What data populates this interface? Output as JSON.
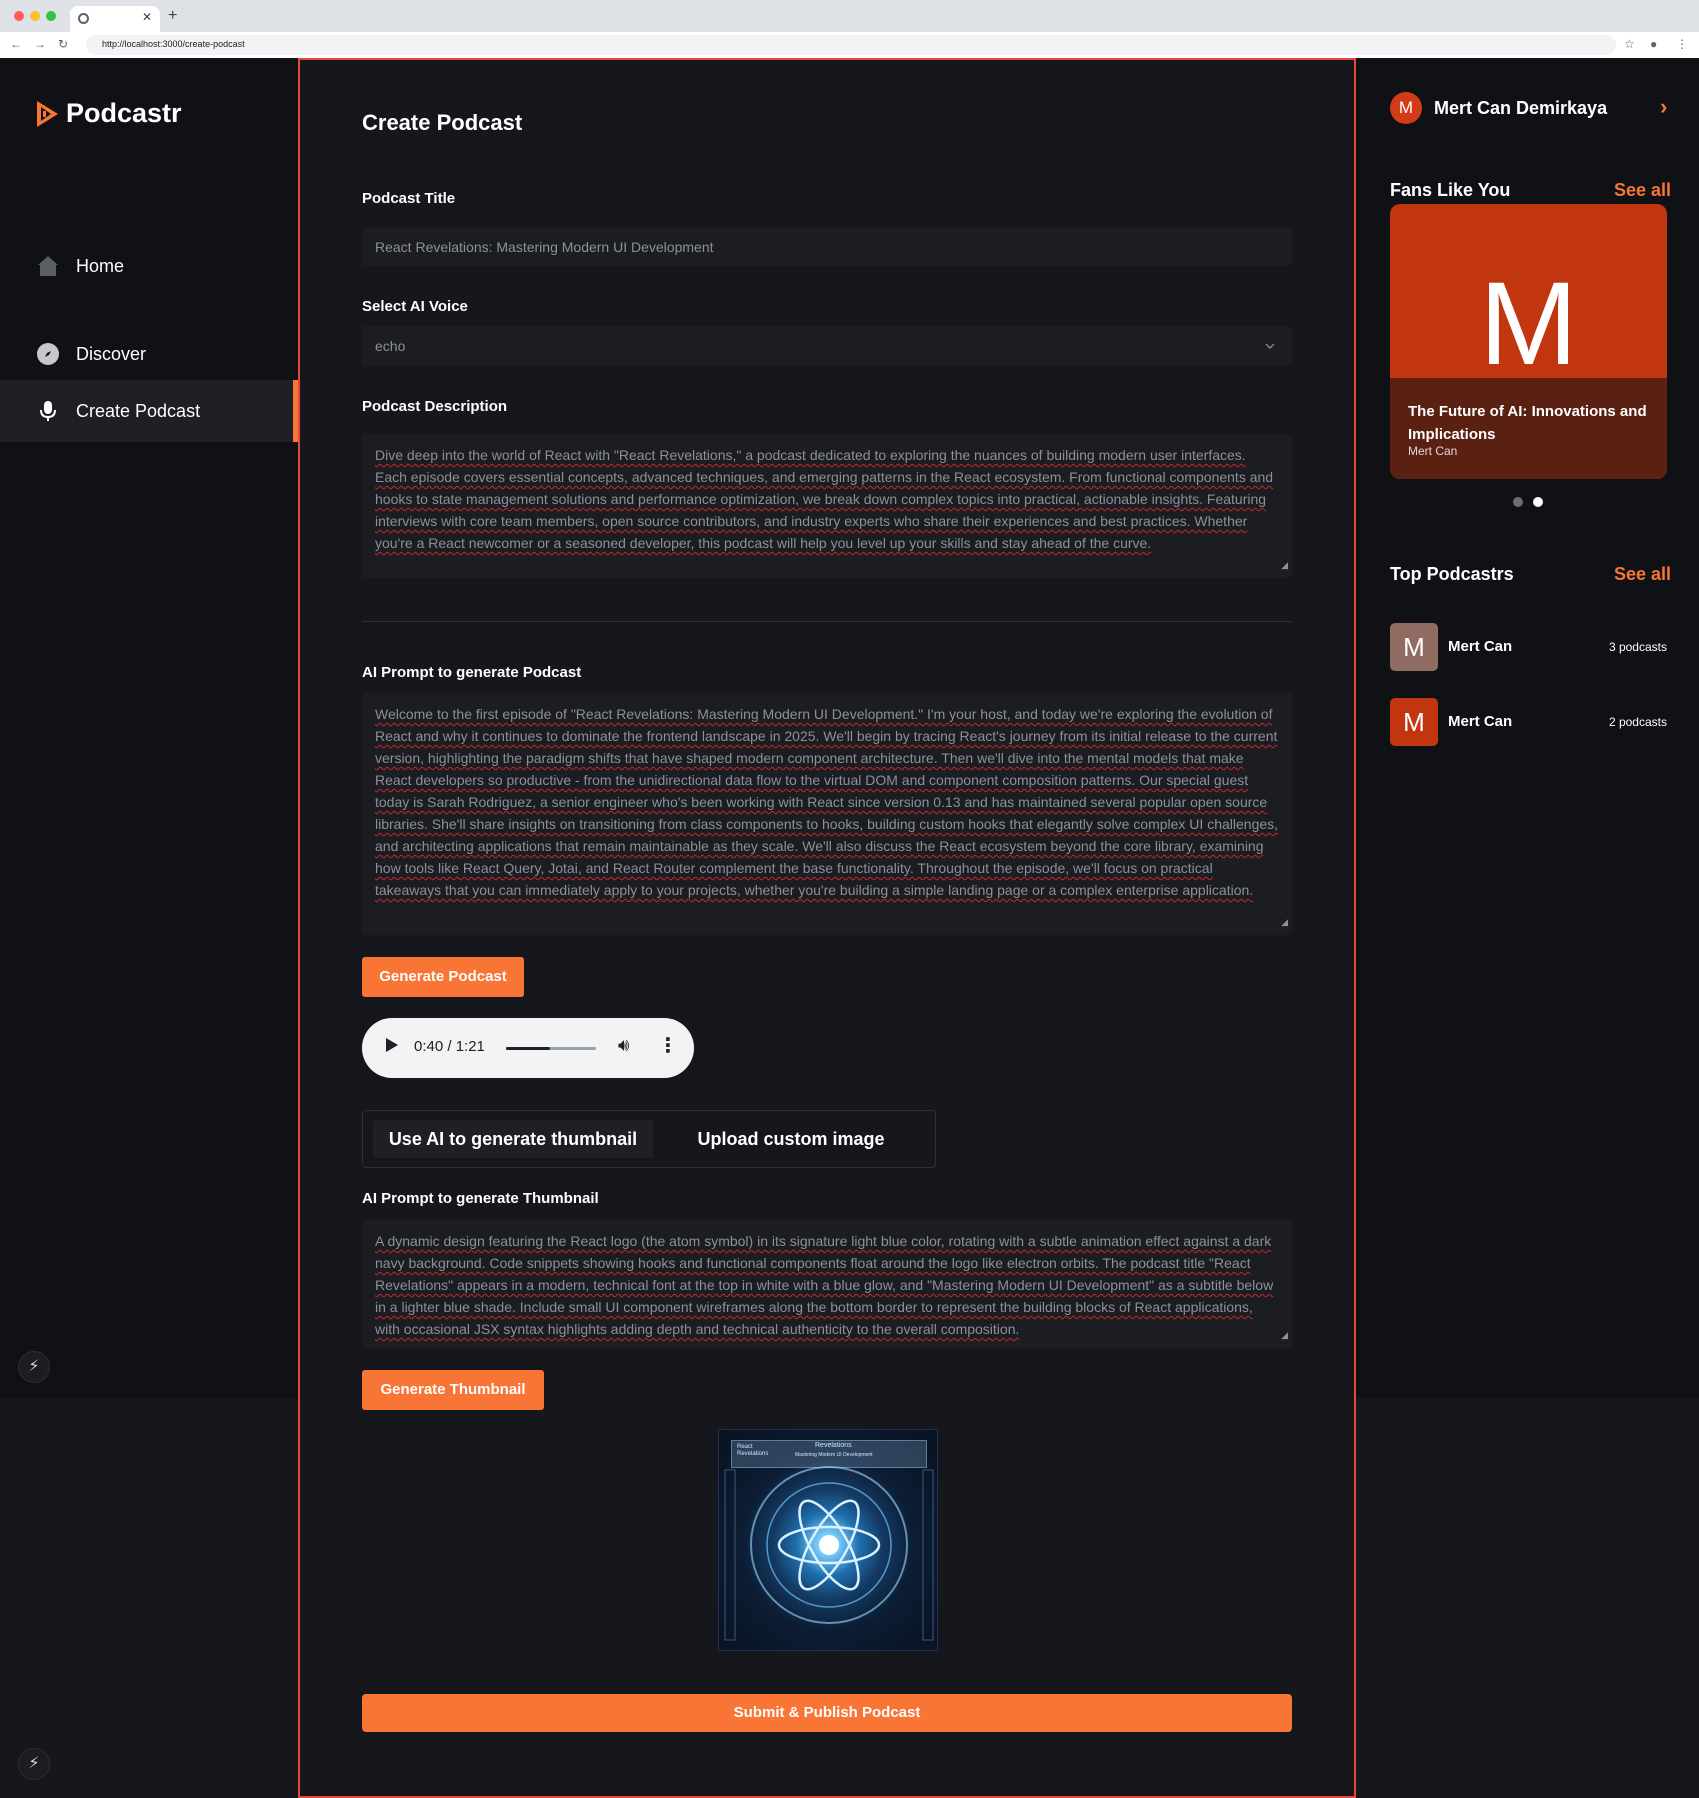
{
  "browser": {
    "url": "http://localhost:3000/create-podcast"
  },
  "sidebar": {
    "logo_text": "Podcastr",
    "items": [
      {
        "label": "Home",
        "icon": "home-icon"
      },
      {
        "label": "Discover",
        "icon": "compass-icon"
      },
      {
        "label": "Create Podcast",
        "icon": "microphone-icon"
      }
    ],
    "active_item": "Create Podcast"
  },
  "main": {
    "page_title": "Create Podcast",
    "podcast_title_label": "Podcast Title",
    "podcast_title_value": "React Revelations: Mastering Modern UI Development",
    "voice_label": "Select AI Voice",
    "voice_value": "echo",
    "description_label": "Podcast Description",
    "description_value": "Dive deep into the world of React with \"React Revelations,\" a podcast dedicated to exploring the nuances of building modern user interfaces. Each episode covers essential concepts, advanced techniques, and emerging patterns in the React ecosystem. From functional components and hooks to state management solutions and performance optimization, we break down complex topics into practical, actionable insights. Featuring interviews with core team members, open source contributors, and industry experts who share their experiences and best practices. Whether you're a React newcomer or a seasoned developer, this podcast will help you level up your skills and stay ahead of the curve.",
    "ai_prompt_label": "AI Prompt to generate Podcast",
    "ai_prompt_value": "Welcome to the first episode of \"React Revelations: Mastering Modern UI Development.\" I'm your host, and today we're exploring the evolution of React and why it continues to dominate the frontend landscape in 2025. We'll begin by tracing React's journey from its initial release to the current version, highlighting the paradigm shifts that have shaped modern component architecture. Then we'll dive into the mental models that make React developers so productive - from the unidirectional data flow to the virtual DOM and component composition patterns. Our special guest today is Sarah Rodriguez, a senior engineer who's been working with React since version 0.13 and has maintained several popular open source libraries. She'll share insights on transitioning from class components to hooks, building custom hooks that elegantly solve complex UI challenges, and architecting applications that remain maintainable as they scale. We'll also discuss the React ecosystem beyond the core library, examining how tools like React Query, Jotai, and React Router complement the base functionality. Throughout the episode, we'll focus on practical takeaways that you can immediately apply to your projects, whether you're building a simple landing page or a complex enterprise application.",
    "generate_podcast_label": "Generate Podcast",
    "audio": {
      "time": "0:40 / 1:21",
      "progress": 0.49
    },
    "thumbnail_tabs": [
      "Use AI to generate thumbnail",
      "Upload custom image"
    ],
    "thumbnail_prompt_label": "AI Prompt to generate Thumbnail",
    "thumbnail_prompt_value": "A dynamic design featuring the React logo (the atom symbol) in its signature light blue color, rotating with a subtle animation effect against a dark navy background. Code snippets showing hooks and functional components float around the logo like electron orbits. The podcast title \"React Revelations\" appears in a modern, technical font at the top in white with a blue glow, and \"Mastering Modern UI Development\" as a subtitle below in a lighter blue shade. Include small UI component wireframes along the bottom border to represent the building blocks of React applications, with occasional JSX syntax highlights adding depth and technical authenticity to the overall composition.",
    "generate_thumbnail_label": "Generate Thumbnail",
    "thumbnail_image": {
      "title": "Revelations",
      "header_left": "React Revelations",
      "subtitle": "Mastering Modern UI Development"
    },
    "submit_label": "Submit & Publish Podcast"
  },
  "right_sidebar": {
    "user_initial": "M",
    "user_name": "Mert Can Demirkaya",
    "fans_title": "Fans Like You",
    "see_all": "See all",
    "fan_card": {
      "letter": "M",
      "title": "The Future of AI: Innovations and Implications",
      "author": "Mert Can"
    },
    "carousel_index": 2,
    "carousel_count": 2,
    "top_title": "Top Podcastrs",
    "top_podcasters": [
      {
        "initial": "M",
        "name": "Mert Can",
        "count": "3 podcasts",
        "color": "#8f6b62"
      },
      {
        "initial": "M",
        "name": "Mert Can",
        "count": "2 podcasts",
        "color": "#c2360f"
      }
    ]
  },
  "colors": {
    "accent": "#f97535",
    "background": "#15171c",
    "sidebar": "#101114",
    "active_border": "#e5483c"
  }
}
